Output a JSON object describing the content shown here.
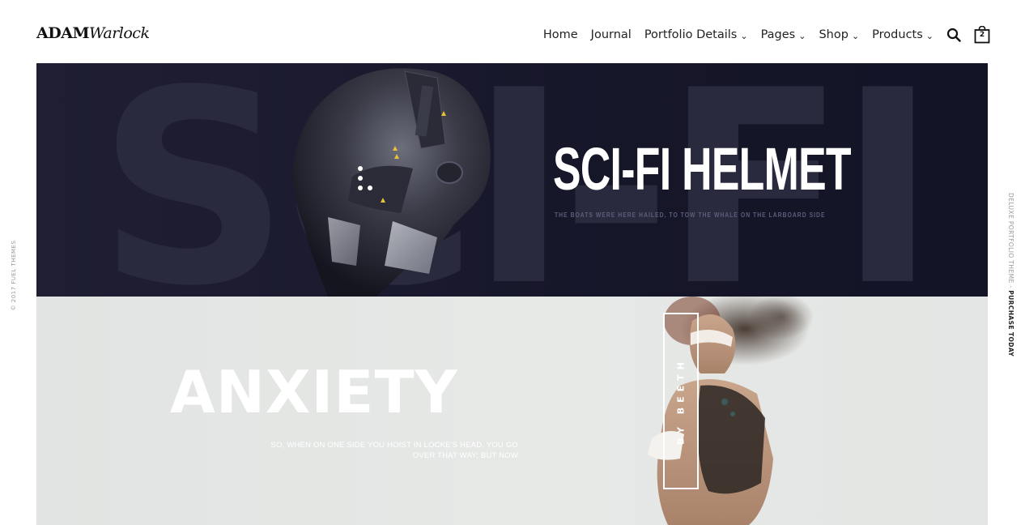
{
  "header": {
    "logo_bold": "ADAM",
    "logo_script": "Warlock",
    "nav": [
      {
        "label": "Home",
        "has_dropdown": false
      },
      {
        "label": "Journal",
        "has_dropdown": false
      },
      {
        "label": "Portfolio Details",
        "has_dropdown": true
      },
      {
        "label": "Pages",
        "has_dropdown": true
      },
      {
        "label": "Shop",
        "has_dropdown": true
      },
      {
        "label": "Products",
        "has_dropdown": true
      }
    ],
    "chevron": "⌄",
    "cart_count": "2",
    "icons": [
      "search-icon",
      "shopping-bag-icon"
    ]
  },
  "side": {
    "left": "© 2017 FUEL THEMES",
    "right_prefix": "DELUXE PORTFOLIO THEME - ",
    "right_bold": "PURCHASE TODAY"
  },
  "banner1": {
    "bg_word": "SCI-FI",
    "title": "SCI-FI HELMET",
    "subtitle": "THE BOATS WERE HERE HAILED, TO TOW THE WHALE ON THE LARBOARD SIDE"
  },
  "banner2": {
    "title": "ANXIETY",
    "subtitle_line1": "SO, WHEN ON ONE SIDE YOU HOIST IN LOCKE'S HEAD, YOU GO",
    "subtitle_line2": "OVER THAT WAY; BUT NOW",
    "byline": "BY BEETH"
  },
  "colors": {
    "banner1_bg": "#1c1b30",
    "banner2_bg": "#e4e7e5",
    "text_dark": "#222222"
  }
}
